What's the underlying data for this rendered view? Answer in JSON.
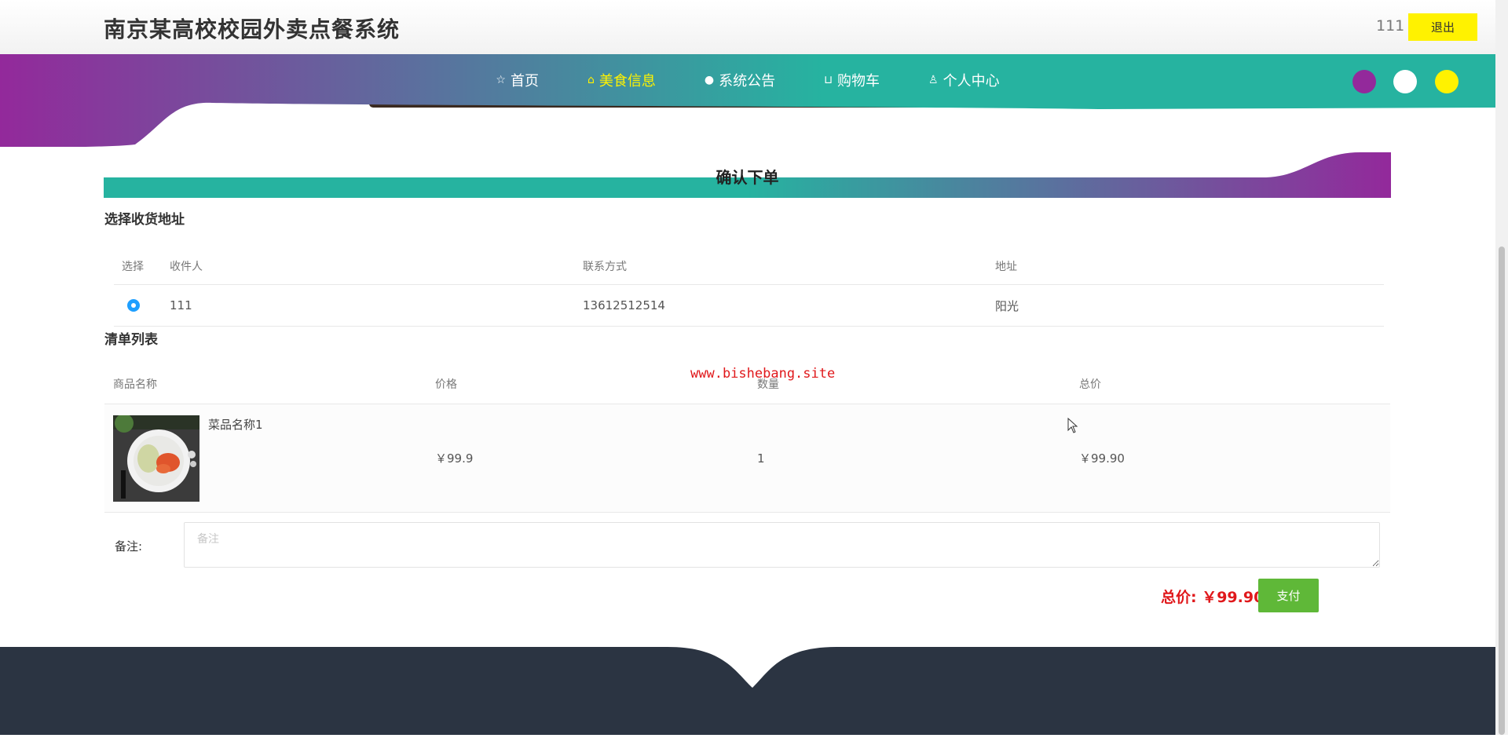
{
  "header": {
    "site_title": "南京某高校校园外卖点餐系统",
    "username": "111",
    "logout_label": "退出"
  },
  "nav": {
    "items": [
      {
        "label": "首页",
        "icon": "star-icon",
        "active": false
      },
      {
        "label": "美食信息",
        "icon": "bag-icon",
        "active": true
      },
      {
        "label": "系统公告",
        "icon": "clock-icon",
        "active": false
      },
      {
        "label": "购物车",
        "icon": "cart-icon",
        "active": false
      },
      {
        "label": "个人中心",
        "icon": "user-icon",
        "active": false
      }
    ],
    "theme_colors": [
      "#93299b",
      "#ffffff",
      "#fff200"
    ]
  },
  "colors": {
    "teal": "#26b3a0",
    "purple": "#93299b",
    "pay_green": "#5fb838",
    "price_red": "#e0181b",
    "footer_dark": "#2b3442"
  },
  "page_title": "确认下单",
  "address": {
    "section_title": "选择收货地址",
    "headers": [
      "选择",
      "收件人",
      "联系方式",
      "地址"
    ],
    "rows": [
      {
        "selected": true,
        "receiver": "111",
        "phone": "13612512514",
        "address": "阳光"
      }
    ]
  },
  "order": {
    "section_title": "清单列表",
    "headers": [
      "商品名称",
      "价格",
      "数量",
      "总价"
    ],
    "rows": [
      {
        "name": "菜品名称1",
        "price": "￥99.9",
        "quantity": "1",
        "subtotal": "￥99.90"
      }
    ]
  },
  "watermark": "www.bishebang.site",
  "remark": {
    "label": "备注:",
    "placeholder": "备注",
    "value": ""
  },
  "total": {
    "text": "总价: ￥99.90"
  },
  "pay_label": "支付"
}
